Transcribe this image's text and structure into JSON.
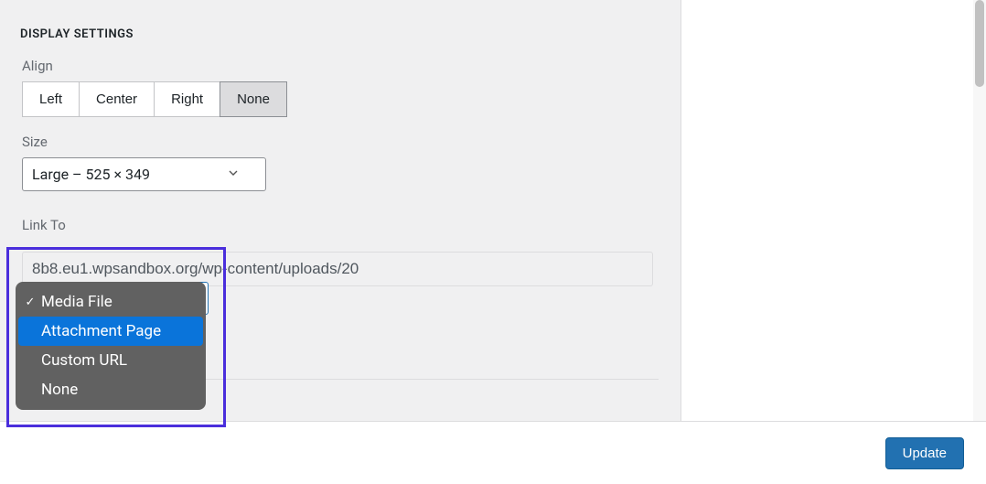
{
  "section_title": "DISPLAY SETTINGS",
  "align": {
    "label": "Align",
    "options": [
      "Left",
      "Center",
      "Right",
      "None"
    ],
    "selected": "None"
  },
  "size": {
    "label": "Size",
    "value": "Large – 525 × 349"
  },
  "link_to": {
    "label": "Link To",
    "options": [
      {
        "label": "Media File",
        "selected": true
      },
      {
        "label": "Attachment Page",
        "highlighted": true
      },
      {
        "label": "Custom URL"
      },
      {
        "label": "None"
      }
    ]
  },
  "url_value": "8b8.eu1.wpsandbox.org/wp-content/uploads/20",
  "update_button": "Update",
  "colors": {
    "highlight": "#4a2edc",
    "primary": "#2271b1",
    "dropdown_bg": "#616161",
    "dropdown_hl": "#0a74da"
  }
}
